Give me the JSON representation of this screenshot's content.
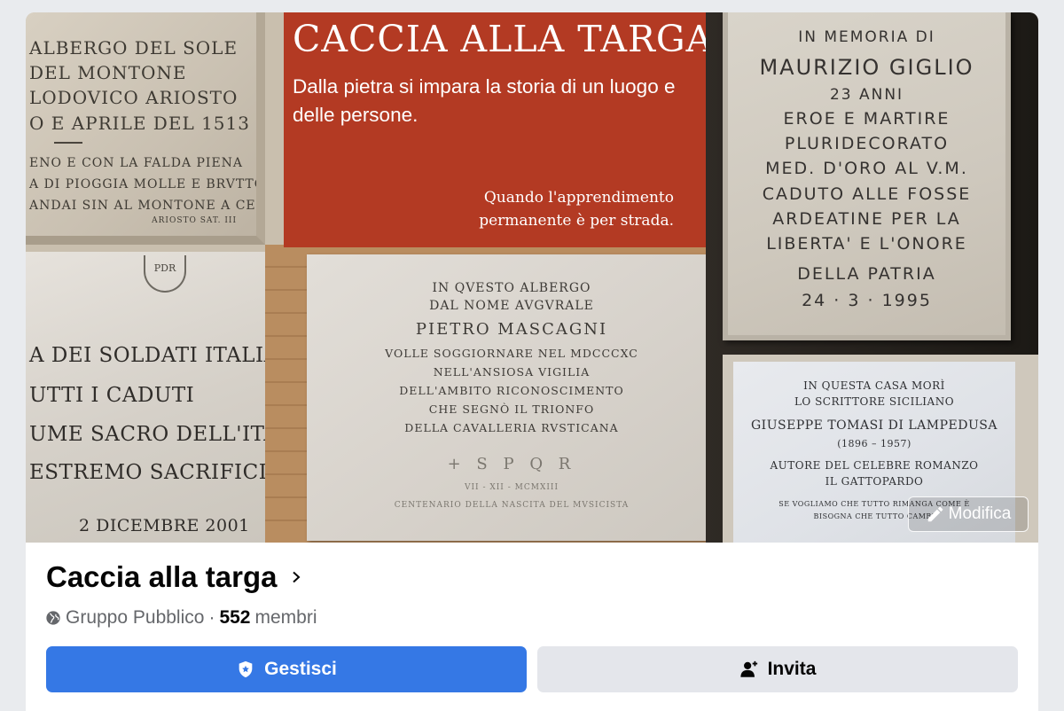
{
  "cover": {
    "banner_title": "CACCIA ALLA TARGA",
    "banner_subtitle": "Dalla pietra si impara la storia di un luogo e delle persone.",
    "banner_note": "Quando l'apprendimento permanente è per strada.",
    "plaque_top_left": [
      "ALBERGO DEL SOLE",
      "DEL MONTONE",
      "LODOVICO ARIOSTO",
      "O E APRILE DEL 1513",
      "ENO E CON LA FALDA PIENA",
      "A DI PIOGGIA MOLLE E BRVTTO,",
      "ANDAI SIN AL MONTONE A CENA.",
      "ARIOSTO SAT. III"
    ],
    "plaque_bottom_left": [
      "A DEI SOLDATI ITALIANI",
      "UTTI I CADUTI",
      "UME SACRO DELL'ITALIA,",
      "ESTREMO SACRIFICIO",
      "2 DICEMBRE 2001"
    ],
    "plaque_bottom_left_emblem": "PDR",
    "plaque_middle": [
      "IN QVESTO ALBERGO",
      "DAL NOME AVGVRALE",
      "PIETRO MASCAGNI",
      "VOLLE SOGGIORNARE NEL MDCCCXC",
      "NELL'ANSIOSA VIGILIA",
      "DELL'AMBITO RICONOSCIMENTO",
      "CHE SEGNÒ IL TRIONFO",
      "DELLA CAVALLERIA RVSTICANA",
      "+ S P Q R",
      "VII - XII - MCMXIII",
      "CENTENARIO DELLA NASCITA DEL MVSICISTA"
    ],
    "plaque_top_right": [
      "IN MEMORIA DI",
      "MAURIZIO GIGLIO",
      "23 ANNI",
      "EROE E MARTIRE",
      "PLURIDECORATO",
      "MED. D'ORO AL V.M.",
      "CADUTO ALLE FOSSE",
      "ARDEATINE PER LA",
      "LIBERTA' E L'ONORE",
      "DELLA PATRIA",
      "24 · 3 · 1995"
    ],
    "plaque_bottom_right": [
      "IN QUESTA CASA MORÌ",
      "LO SCRITTORE SICILIANO",
      "GIUSEPPE TOMASI DI LAMPEDUSA",
      "(1896 – 1957)",
      "AUTORE DEL CELEBRE ROMANZO",
      "IL GATTOPARDO",
      "SE VOGLIAMO CHE TUTTO RIMANGA COME È",
      "BISOGNA CHE TUTTO CAMBI"
    ],
    "edit_label": "Modifica"
  },
  "group": {
    "name": "Caccia alla targa",
    "privacy": "Gruppo Pubblico",
    "separator": "·",
    "member_count": "552",
    "member_label": "membri"
  },
  "actions": {
    "manage_label": "Gestisci",
    "invite_label": "Invita"
  },
  "colors": {
    "banner": "#b33a23",
    "primary": "#3578e5",
    "secondary": "#e4e6eb"
  }
}
